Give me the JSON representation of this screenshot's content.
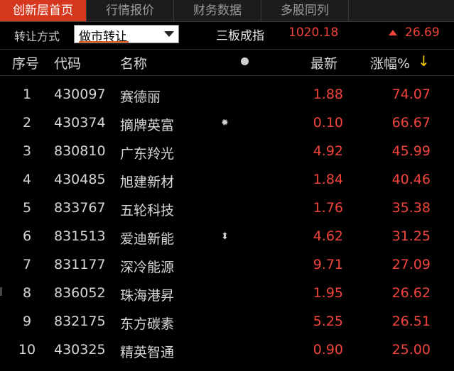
{
  "tabs": [
    {
      "label": "创新层首页",
      "active": true
    },
    {
      "label": "行情报价",
      "active": false
    },
    {
      "label": "财务数据",
      "active": false
    },
    {
      "label": "多股同列",
      "active": false
    }
  ],
  "filter": {
    "label": "转让方式",
    "selected": "做市转让"
  },
  "index": {
    "name": "三板成指",
    "value": "1020.18",
    "change": "26.69"
  },
  "columns": {
    "index": "序号",
    "code": "代码",
    "name": "名称",
    "price": "最新",
    "change_pct": "涨幅%"
  },
  "colors": {
    "accent": "#d5381f",
    "up": "#f0443c",
    "sort_arrow": "#f5d000"
  },
  "rows": [
    {
      "index": "1",
      "code": "430097",
      "name": "赛德丽",
      "price": "1.88",
      "change_pct": "74.07",
      "icon": ""
    },
    {
      "index": "2",
      "code": "430374",
      "name": "摘牌英富",
      "price": "0.10",
      "change_pct": "66.67",
      "icon": "sun-icon"
    },
    {
      "index": "3",
      "code": "830810",
      "name": "广东羚光",
      "price": "4.92",
      "change_pct": "45.99",
      "icon": ""
    },
    {
      "index": "4",
      "code": "430485",
      "name": "旭建新材",
      "price": "1.84",
      "change_pct": "40.46",
      "icon": ""
    },
    {
      "index": "5",
      "code": "833767",
      "name": "五轮科技",
      "price": "1.76",
      "change_pct": "35.38",
      "icon": ""
    },
    {
      "index": "6",
      "code": "831513",
      "name": "爱迪新能",
      "price": "4.62",
      "change_pct": "31.25",
      "icon": "updown-arrow-icon"
    },
    {
      "index": "7",
      "code": "831177",
      "name": "深冷能源",
      "price": "9.71",
      "change_pct": "27.09",
      "icon": ""
    },
    {
      "index": "8",
      "code": "836052",
      "name": "珠海港昇",
      "price": "1.95",
      "change_pct": "26.62",
      "icon": ""
    },
    {
      "index": "9",
      "code": "832175",
      "name": "东方碳素",
      "price": "5.25",
      "change_pct": "26.51",
      "icon": ""
    },
    {
      "index": "10",
      "code": "430325",
      "name": "精英智通",
      "price": "0.90",
      "change_pct": "25.00",
      "icon": ""
    }
  ]
}
